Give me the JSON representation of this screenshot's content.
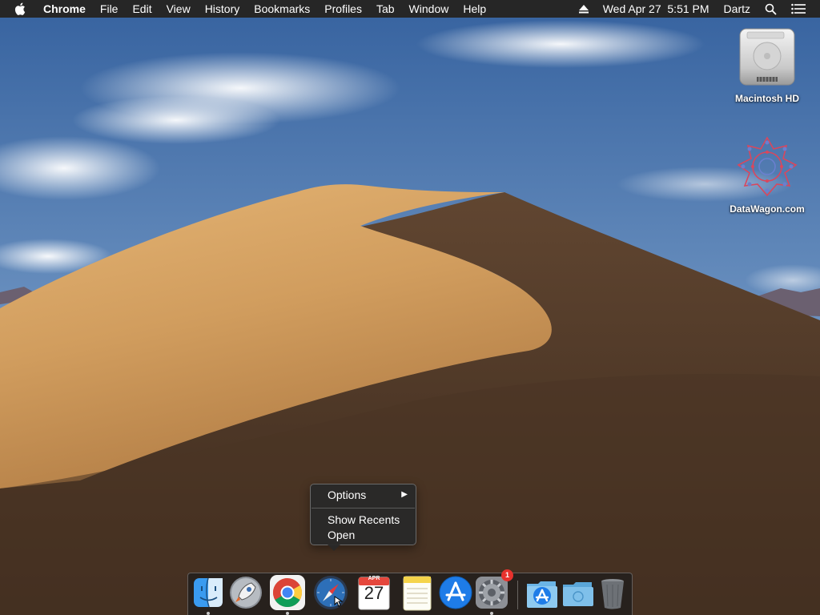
{
  "menubar": {
    "app_name": "Chrome",
    "menus": [
      "File",
      "Edit",
      "View",
      "History",
      "Bookmarks",
      "Profiles",
      "Tab",
      "Window",
      "Help"
    ],
    "datetime": "Wed Apr 27  5:51 PM",
    "user": "Dartz",
    "icons": [
      "apple-logo-icon",
      "eject-icon",
      "spotlight-search-icon",
      "notification-center-icon"
    ]
  },
  "desktop": {
    "wallpaper": "macOS Mojave desert dunes",
    "icons": [
      {
        "label": "Macintosh HD",
        "icon": "hard-drive-icon"
      },
      {
        "label": "DataWagon.com",
        "icon": "datawagon-logo-icon"
      }
    ]
  },
  "context_menu": {
    "items": [
      {
        "label": "Options",
        "has_submenu": true
      },
      {
        "label": "Show Recents",
        "has_submenu": false
      },
      {
        "label": "Open",
        "has_submenu": false
      }
    ]
  },
  "dock": {
    "items": [
      {
        "name": "Finder",
        "icon": "finder-icon",
        "running": true
      },
      {
        "name": "Launchpad",
        "icon": "launchpad-icon",
        "running": false
      },
      {
        "name": "Google Chrome",
        "icon": "chrome-icon",
        "running": true
      },
      {
        "name": "Safari",
        "icon": "safari-icon",
        "running": false
      },
      {
        "name": "Calendar",
        "icon": "calendar-icon",
        "running": false,
        "month": "APR",
        "day": "27"
      },
      {
        "name": "Notes",
        "icon": "notes-icon",
        "running": false
      },
      {
        "name": "App Store",
        "icon": "app-store-icon",
        "running": false
      },
      {
        "name": "System Preferences",
        "icon": "system-preferences-icon",
        "running": true,
        "badge": "1"
      },
      {
        "name": "Applications",
        "icon": "applications-folder-icon",
        "running": false
      },
      {
        "name": "Downloads",
        "icon": "downloads-folder-icon",
        "running": false
      },
      {
        "name": "Trash",
        "icon": "trash-icon",
        "running": false
      }
    ]
  },
  "colors": {
    "menubar_bg": "#262626",
    "sky_top": "#3c6aa8",
    "sky_bottom": "#a9bfd6",
    "dune_light": "#d8a866",
    "dune_shadow": "#5a4330",
    "badge_red": "#e8322d"
  }
}
